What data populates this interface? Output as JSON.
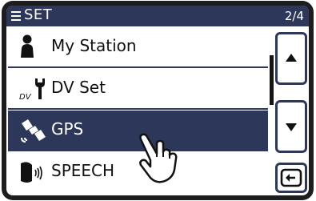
{
  "header": {
    "title": "SET",
    "page_indicator": "2/4"
  },
  "menu": {
    "items": [
      {
        "label": "My Station",
        "icon": "person-icon",
        "selected": false
      },
      {
        "label": "DV Set",
        "icon": "dv-wrench-icon",
        "selected": false
      },
      {
        "label": "GPS",
        "icon": "satellite-icon",
        "selected": true
      },
      {
        "label": "SPEECH",
        "icon": "speaker-icon",
        "selected": false
      }
    ]
  },
  "side_buttons": {
    "up": "up-arrow-icon",
    "down": "down-arrow-icon",
    "back": "return-icon"
  },
  "colors": {
    "header_bg": "#2c3759",
    "selected_bg": "#2c3759",
    "bezel": "#1d1d1f"
  }
}
